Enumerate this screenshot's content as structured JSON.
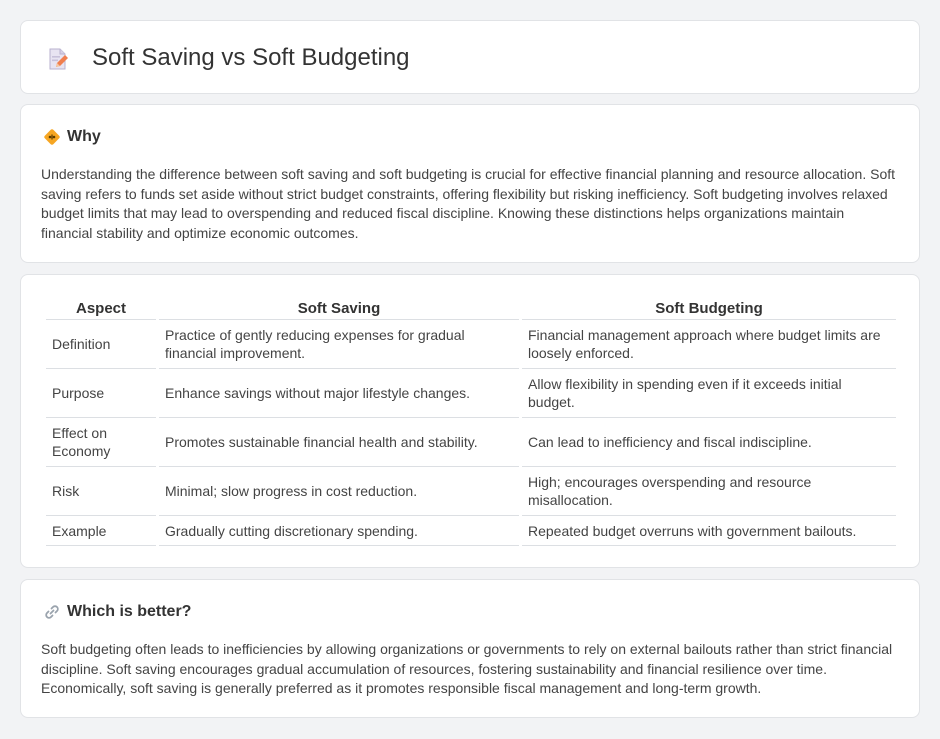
{
  "header": {
    "title": "Soft Saving vs Soft Budgeting",
    "icon": "document-edit-icon"
  },
  "why": {
    "icon": "diamond-sign-icon",
    "title": "Why",
    "body": "Understanding the difference between soft saving and soft budgeting is crucial for effective financial planning and resource allocation. Soft saving refers to funds set aside without strict budget constraints, offering flexibility but risking inefficiency. Soft budgeting involves relaxed budget limits that may lead to overspending and reduced fiscal discipline. Knowing these distinctions helps organizations maintain financial stability and optimize economic outcomes."
  },
  "table": {
    "headers": [
      "Aspect",
      "Soft Saving",
      "Soft Budgeting"
    ],
    "rows": [
      [
        "Definition",
        "Practice of gently reducing expenses for gradual financial improvement.",
        "Financial management approach where budget limits are loosely enforced."
      ],
      [
        "Purpose",
        "Enhance savings without major lifestyle changes.",
        "Allow flexibility in spending even if it exceeds initial budget."
      ],
      [
        "Effect on Economy",
        "Promotes sustainable financial health and stability.",
        "Can lead to inefficiency and fiscal indiscipline."
      ],
      [
        "Risk",
        "Minimal; slow progress in cost reduction.",
        "High; encourages overspending and resource misallocation."
      ],
      [
        "Example",
        "Gradually cutting discretionary spending.",
        "Repeated budget overruns with government bailouts."
      ]
    ]
  },
  "better": {
    "icon": "link-icon",
    "title": "Which is better?",
    "body": "Soft budgeting often leads to inefficiencies by allowing organizations or governments to rely on external bailouts rather than strict financial discipline. Soft saving encourages gradual accumulation of resources, fostering sustainability and financial resilience over time. Economically, soft saving is generally preferred as it promotes responsible fiscal management and long-term growth."
  }
}
